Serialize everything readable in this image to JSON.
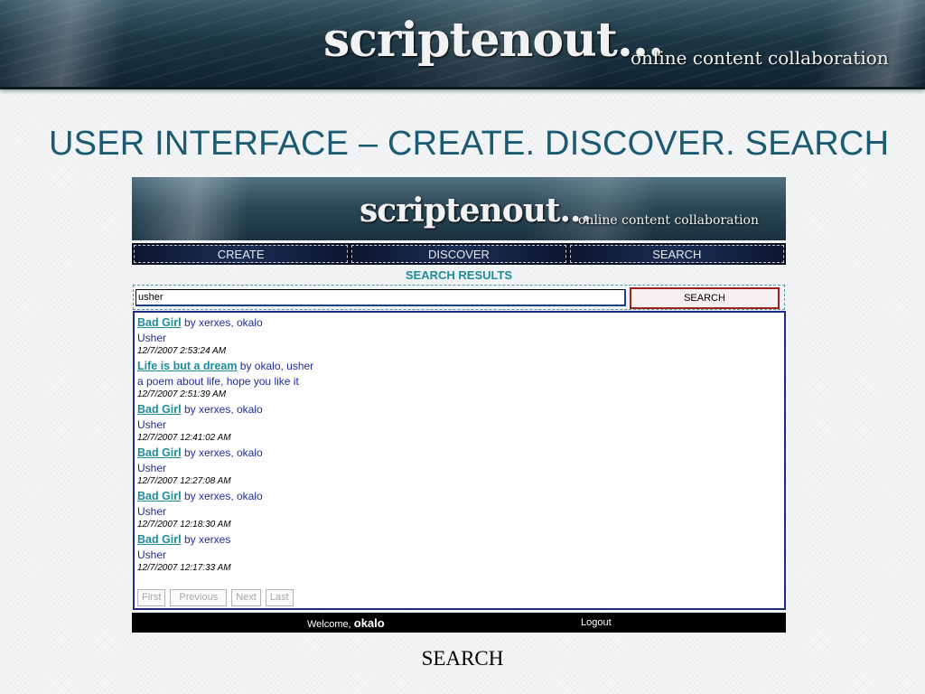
{
  "slide": {
    "banner_logo": "scriptenout...",
    "banner_tagline": "online content collaboration",
    "title": "USER INTERFACE – CREATE. DISCOVER. SEARCH",
    "caption": "SEARCH"
  },
  "app": {
    "logo": "scriptenout...",
    "tagline": "online content collaboration",
    "nav": [
      "CREATE",
      "DISCOVER",
      "SEARCH"
    ],
    "results_title": "SEARCH RESULTS",
    "search": {
      "value": "usher",
      "button_label": "SEARCH"
    },
    "results": [
      {
        "title": "Bad Girl",
        "by": "by xerxes, okalo",
        "description": "Usher",
        "timestamp": "12/7/2007 2:53:24 AM"
      },
      {
        "title": "Life is but a dream",
        "by": "by okalo, usher",
        "description": "a poem about life, hope you like it",
        "timestamp": "12/7/2007 2:51:39 AM"
      },
      {
        "title": "Bad Girl",
        "by": "by xerxes, okalo",
        "description": "Usher",
        "timestamp": "12/7/2007 12:41:02 AM"
      },
      {
        "title": "Bad Girl",
        "by": "by xerxes, okalo",
        "description": "Usher",
        "timestamp": "12/7/2007 12:27:08 AM"
      },
      {
        "title": "Bad Girl",
        "by": "by xerxes, okalo",
        "description": "Usher",
        "timestamp": "12/7/2007 12:18:30 AM"
      },
      {
        "title": "Bad Girl",
        "by": "by xerxes",
        "description": "Usher",
        "timestamp": "12/7/2007 12:17:33 AM"
      }
    ],
    "pager": {
      "first": "First",
      "previous": "Previous",
      "next": "Next",
      "last": "Last"
    },
    "footer": {
      "welcome": "Welcome,",
      "user": "okalo",
      "logout": "Logout"
    }
  },
  "colors": {
    "title": "#1b5b72",
    "link": "#1c8c9a",
    "text_blue": "#1f2c9a",
    "panel_border": "#1a2b8a",
    "button_border": "#a02020"
  }
}
